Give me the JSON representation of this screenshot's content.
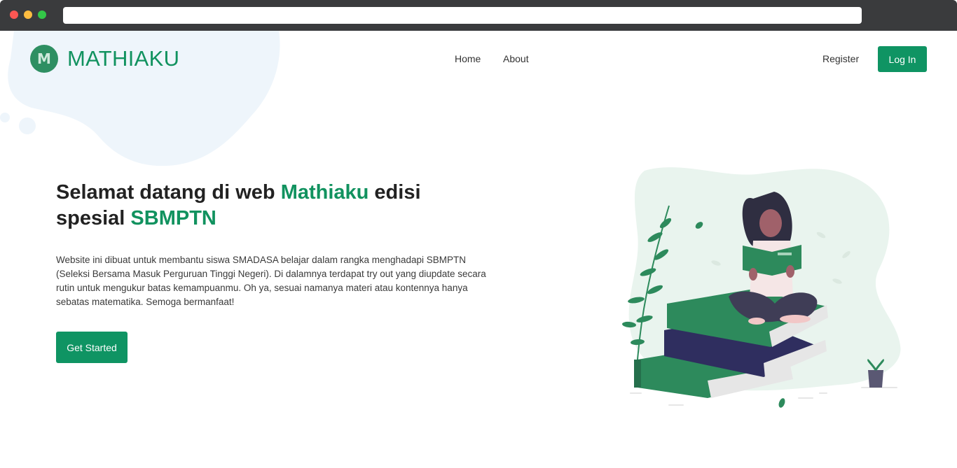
{
  "nav": {
    "brand": "MATHIAKU",
    "brand_initial": "M",
    "links": [
      "Home",
      "About"
    ],
    "register_label": "Register",
    "login_label": "Log In"
  },
  "hero": {
    "title_part1": "Selamat datang di web ",
    "title_brand": "Mathiaku",
    "title_part2": " edisi spesial ",
    "title_exam": "SBMPTN",
    "description": "Website ini dibuat untuk membantu siswa SMADASA belajar dalam rangka menghadapi SBMPTN (Seleksi Bersama Masuk Perguruan Tinggi Negeri). Di dalamnya terdapat try out yang diupdate secara rutin untuk mengukur batas kemampuanmu. Oh ya, sesuai namanya materi atau kontennya hanya sebatas matematika. Semoga bermanfaat!",
    "cta_label": "Get Started"
  },
  "colors": {
    "accent": "#11925f",
    "button": "#0f9463",
    "blob": "#eef5fb"
  },
  "icons": {
    "illustration": "woman-reading-on-books-illustration"
  }
}
